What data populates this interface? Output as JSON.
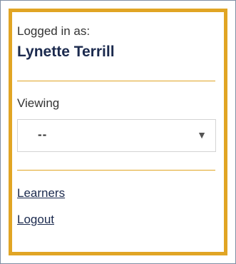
{
  "user_panel": {
    "logged_in_label": "Logged in as:",
    "user_name": "Lynette Terrill",
    "viewing_label": "Viewing",
    "viewing_select": {
      "selected_value": "--",
      "arrow_icon": "triangle-down-icon"
    },
    "links": [
      {
        "label": "Learners"
      },
      {
        "label": "Logout"
      }
    ]
  },
  "colors": {
    "accent": "#e1a524",
    "name_text": "#1b2a4e"
  }
}
